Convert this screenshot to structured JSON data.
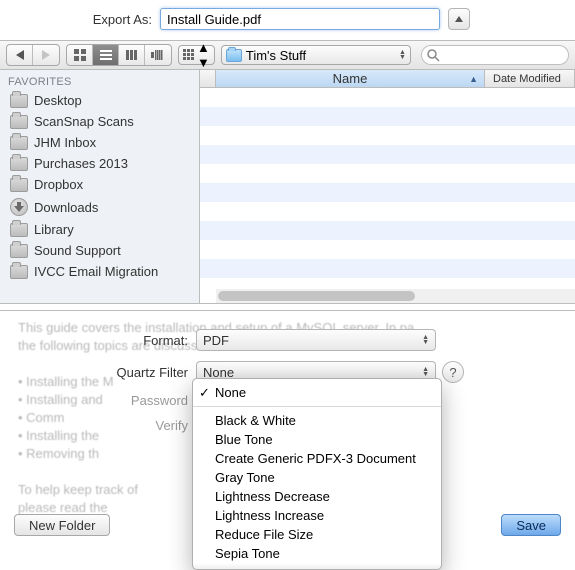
{
  "export": {
    "label": "Export As:",
    "filename": "Install Guide.pdf"
  },
  "toolbar": {
    "folder_name": "Tim's Stuff",
    "search_placeholder": ""
  },
  "sidebar": {
    "header": "FAVORITES",
    "items": [
      {
        "label": "Desktop",
        "icon": "folder"
      },
      {
        "label": "ScanSnap Scans",
        "icon": "folder"
      },
      {
        "label": "JHM Inbox",
        "icon": "folder"
      },
      {
        "label": "Purchases 2013",
        "icon": "folder"
      },
      {
        "label": "Dropbox",
        "icon": "folder"
      },
      {
        "label": "Downloads",
        "icon": "download"
      },
      {
        "label": "Library",
        "icon": "folder"
      },
      {
        "label": "Sound Support",
        "icon": "folder"
      },
      {
        "label": "IVCC Email Migration",
        "icon": "folder"
      }
    ]
  },
  "list": {
    "columns": {
      "name": "Name",
      "date": "Date Modified"
    }
  },
  "form": {
    "format_label": "Format:",
    "format_value": "PDF",
    "quartz_label": "Quartz Filter",
    "password_label": "Password",
    "verify_label": "Verify"
  },
  "quartz_menu": {
    "selected": "None",
    "items": [
      "None",
      "Black & White",
      "Blue Tone",
      "Create Generic PDFX-3 Document",
      "Gray Tone",
      "Lightness Decrease",
      "Lightness Increase",
      "Reduce File Size",
      "Sepia Tone"
    ]
  },
  "buttons": {
    "new_folder": "New Folder",
    "save": "Save"
  },
  "bg_text": {
    "l1": "This guide covers the installation and setup of a MySQL server. In pa",
    "l2": "the following topics are discussed:",
    "l3": "• Installing the M",
    "l4": "• Installing and",
    "l5": "• Comm",
    "l6": "• Installing the",
    "l7": "• Removing th",
    "l8": "To help keep track of",
    "l9": "please read the"
  }
}
